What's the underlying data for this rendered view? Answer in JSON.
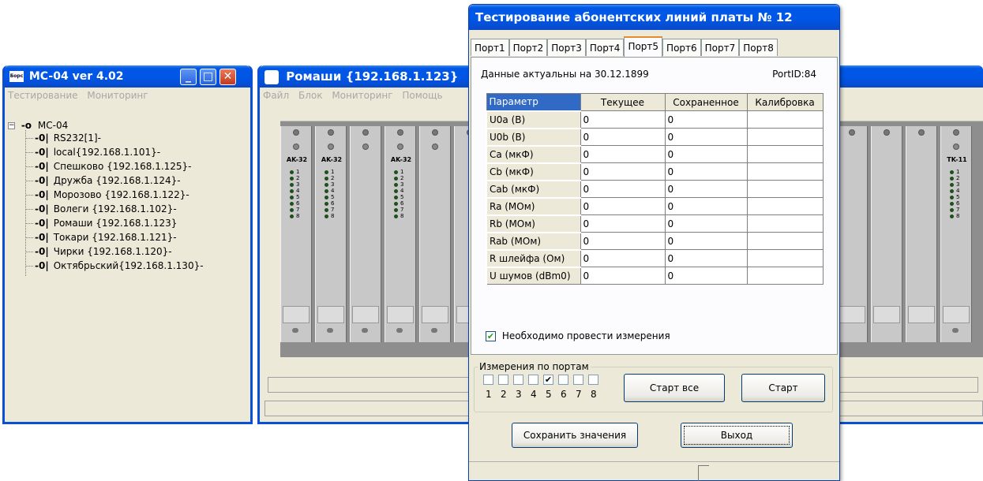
{
  "win1": {
    "title": "MC-04  ver 4.02",
    "icon_text": "Борс",
    "menu": [
      "Тестирование",
      "Мониторинг"
    ],
    "tree": {
      "root": "MC-04",
      "items": [
        "RS232[1]-",
        "local{192.168.1.101}-",
        "Спешково  {192.168.1.125}-",
        "Дружба {192.168.1.124}-",
        "Морозово {192.168.1.122}-",
        "Волеги {192.168.1.102}-",
        "Ромаши {192.168.1.123}",
        "Токари {192.168.1.121}-",
        "Чирки {192.168.1.120}-",
        "Октябрьский{192.168.1.130}-"
      ]
    }
  },
  "win2": {
    "title": "Ромаши {192.168.1.123}",
    "menu": [
      "Файл",
      "Блок",
      "Мониторинг",
      "Помощь"
    ],
    "cards": [
      {
        "label": "AK-32",
        "leds": true
      },
      {
        "label": "AK-32",
        "leds": true
      },
      {
        "label": "",
        "leds": false
      },
      {
        "label": "AK-32",
        "leds": true
      },
      {
        "label": "",
        "leds": false
      },
      {
        "label": "TK-11",
        "leds": true
      }
    ],
    "led_numbers": [
      "1",
      "2",
      "3",
      "4",
      "5",
      "6",
      "7",
      "8"
    ]
  },
  "dialog": {
    "title": "Тестирование абонентских линий платы № 12",
    "tabs": [
      "Порт1",
      "Порт2",
      "Порт3",
      "Порт4",
      "Порт5",
      "Порт6",
      "Порт7",
      "Порт8"
    ],
    "active_tab": "Порт5",
    "data_date": "Данные актуальны на 30.12.1899",
    "port_id": "PortID:84",
    "columns": [
      "Параметр",
      "Текущее",
      "Сохраненное",
      "Калибровка"
    ],
    "rows": [
      [
        "U0a (В)",
        "0",
        "0",
        ""
      ],
      [
        "U0b (В)",
        "0",
        "0",
        ""
      ],
      [
        "Ca (мкФ)",
        "0",
        "0",
        ""
      ],
      [
        "Cb (мкФ)",
        "0",
        "0",
        ""
      ],
      [
        "Cab (мкФ)",
        "0",
        "0",
        ""
      ],
      [
        "Ra (МОм)",
        "0",
        "0",
        ""
      ],
      [
        "Rb (МОм)",
        "0",
        "0",
        ""
      ],
      [
        "Rab (МОм)",
        "0",
        "0",
        ""
      ],
      [
        "R шлейфа (Ом)",
        "0",
        "0",
        ""
      ],
      [
        "U шумов (dBm0)",
        "0",
        "0",
        ""
      ]
    ],
    "need_measure_label": "Необходимо провести измерения",
    "need_measure_checked": true,
    "ports_group_label": "Измерения по портам",
    "port_checks": [
      false,
      false,
      false,
      false,
      true,
      false,
      false,
      false
    ],
    "port_numbers": [
      "1",
      "2",
      "3",
      "4",
      "5",
      "6",
      "7",
      "8"
    ],
    "start_all_label": "Старт все",
    "start_label": "Старт",
    "save_label": "Сохранить значения",
    "exit_label": "Выход"
  }
}
